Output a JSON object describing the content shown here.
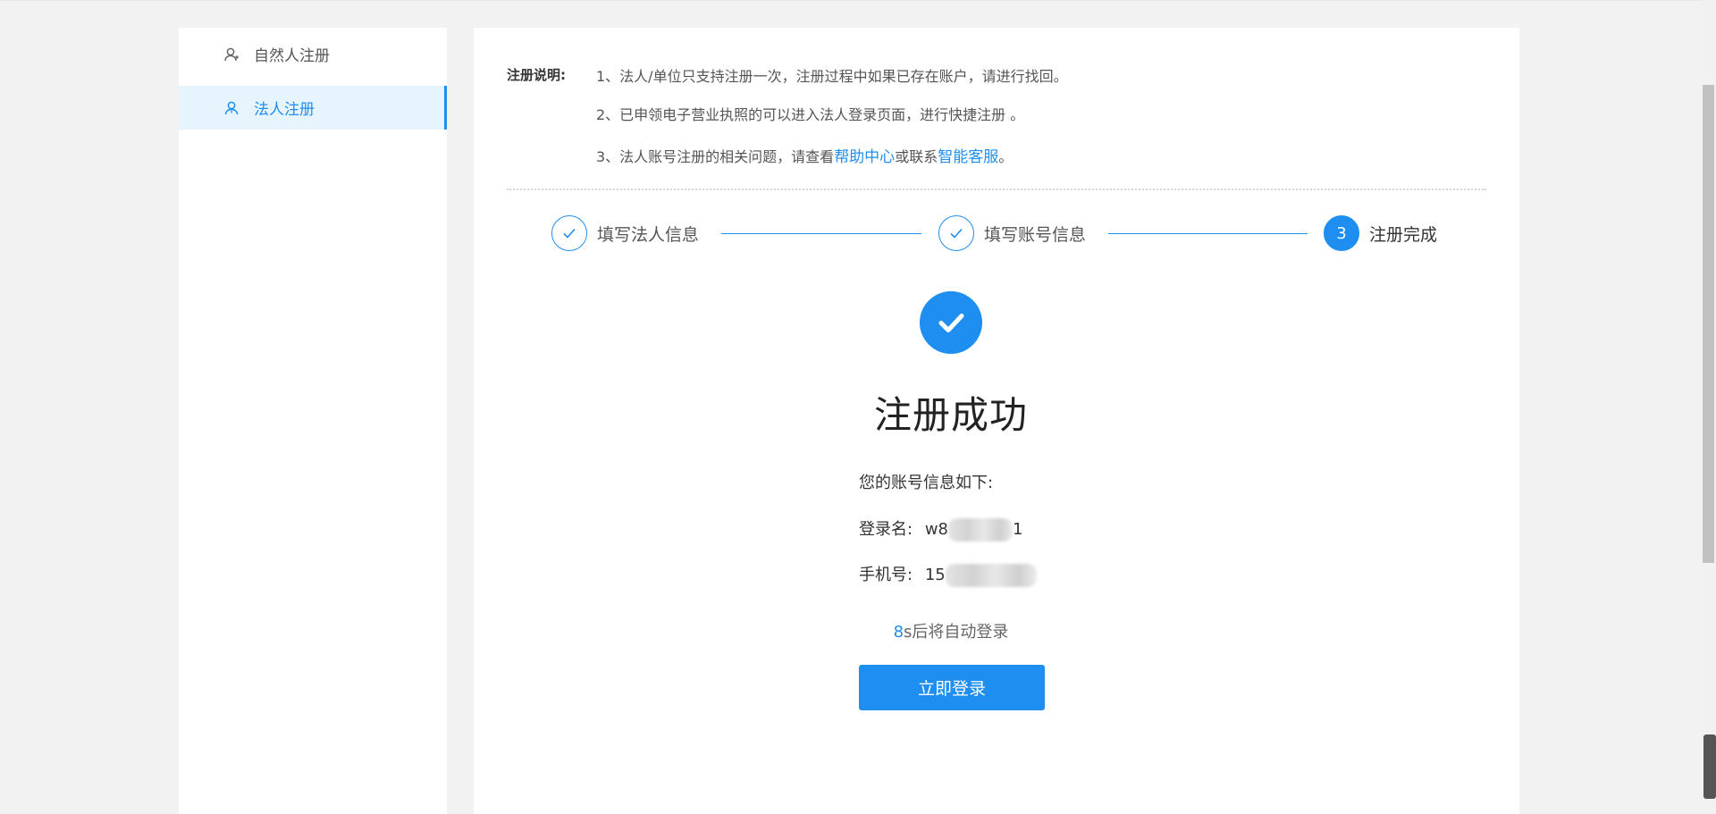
{
  "sidebar": {
    "items": [
      {
        "label": "自然人注册",
        "icon": "user-icon",
        "active": false
      },
      {
        "label": "法人注册",
        "icon": "user-icon",
        "active": true
      }
    ]
  },
  "notes": {
    "label": "注册说明:",
    "line1": "1、法人/单位只支持注册一次，注册过程中如果已存在账户，请进行找回。",
    "line2": "2、已申领电子营业执照的可以进入法人登录页面，进行快捷注册 。",
    "line3_prefix": "3、法人账号注册的相关问题，请查看",
    "line3_link1": "帮助中心",
    "line3_mid": "或联系",
    "line3_link2": "智能客服",
    "line3_suffix": "。"
  },
  "steps": [
    {
      "label": "填写法人信息",
      "status": "done"
    },
    {
      "label": "填写账号信息",
      "status": "done"
    },
    {
      "label": "注册完成",
      "number": "3",
      "status": "active"
    }
  ],
  "result": {
    "title": "注册成功",
    "intro": "您的账号信息如下:",
    "login_name_label": "登录名:",
    "login_name_prefix": "w8",
    "login_name_suffix": "1",
    "phone_label": "手机号:",
    "phone_prefix": "15",
    "countdown_num": "8",
    "countdown_text": "s后将自动登录",
    "login_button": "立即登录"
  },
  "colors": {
    "accent": "#1e8ef0",
    "background": "#f2f2f2",
    "active_bg": "#e6f4fe"
  }
}
